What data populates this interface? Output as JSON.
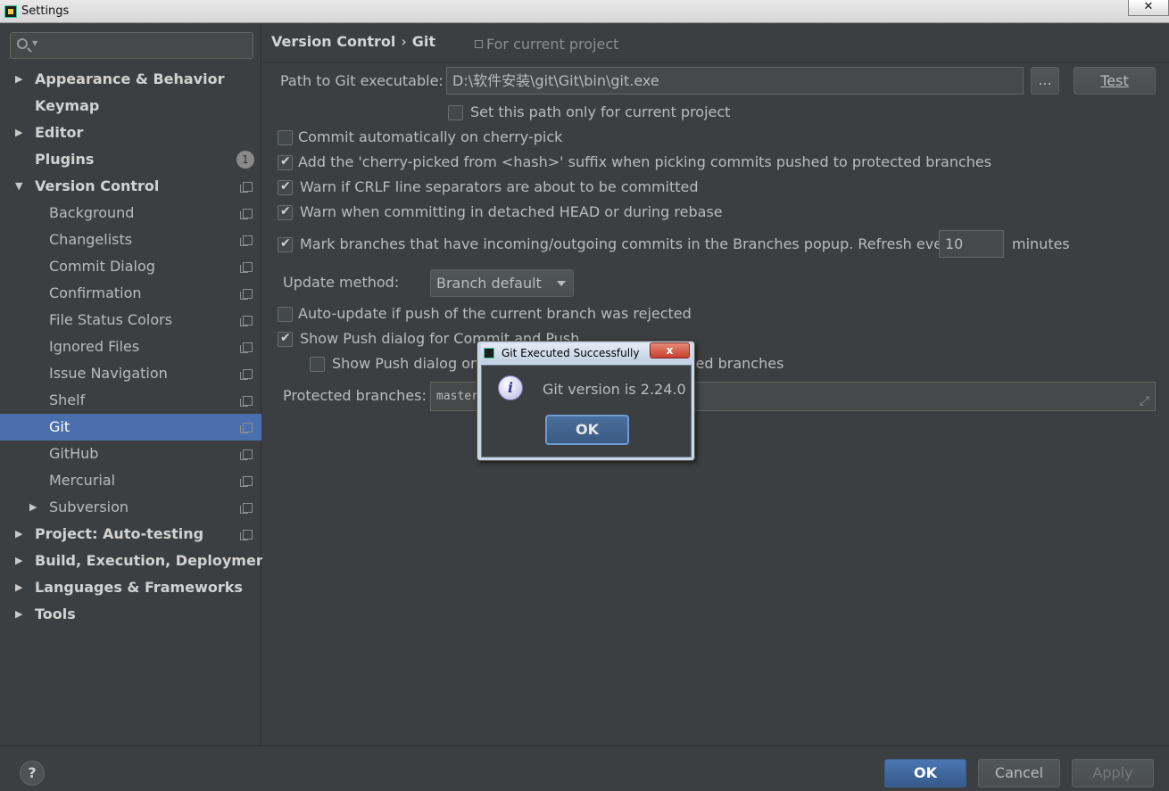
{
  "window": {
    "title": "Settings",
    "close_label": "✕"
  },
  "sidebar": {
    "search_placeholder": "",
    "items": [
      {
        "label": "Appearance & Behavior",
        "level": 0,
        "arrow": "▶"
      },
      {
        "label": "Keymap",
        "level": 0
      },
      {
        "label": "Editor",
        "level": 0,
        "arrow": "▶"
      },
      {
        "label": "Plugins",
        "level": 0,
        "badge": "1"
      },
      {
        "label": "Version Control",
        "level": 0,
        "arrow": "▼"
      },
      {
        "label": "Background",
        "level": 1
      },
      {
        "label": "Changelists",
        "level": 1
      },
      {
        "label": "Commit Dialog",
        "level": 1
      },
      {
        "label": "Confirmation",
        "level": 1
      },
      {
        "label": "File Status Colors",
        "level": 1
      },
      {
        "label": "Ignored Files",
        "level": 1
      },
      {
        "label": "Issue Navigation",
        "level": 1
      },
      {
        "label": "Shelf",
        "level": 1
      },
      {
        "label": "Git",
        "level": 1,
        "selected": true
      },
      {
        "label": "GitHub",
        "level": 1
      },
      {
        "label": "Mercurial",
        "level": 1
      },
      {
        "label": "Subversion",
        "level": 1,
        "arrow": "▶"
      },
      {
        "label": "Project: Auto-testing",
        "level": 0,
        "arrow": "▶"
      },
      {
        "label": "Build, Execution, Deployment",
        "level": 0,
        "arrow": "▶"
      },
      {
        "label": "Languages & Frameworks",
        "level": 0,
        "arrow": "▶"
      },
      {
        "label": "Tools",
        "level": 0,
        "arrow": "▶"
      }
    ]
  },
  "main": {
    "breadcrumb": {
      "parent": "Version Control",
      "separator": "›",
      "current": "Git"
    },
    "scope_note": "For current project",
    "path": {
      "label": "Path to Git executable:",
      "value": "D:\\软件安装\\git\\Git\\bin\\git.exe",
      "browse_label": "...",
      "test_label": "Test"
    },
    "options": {
      "path_only_project": {
        "label": "Set this path only for current project",
        "checked": false
      },
      "commit_cherry_pick": {
        "label": "Commit automatically on cherry-pick",
        "checked": false
      },
      "cherry_suffix": {
        "label": "Add the 'cherry-picked from <hash>' suffix when picking commits pushed to protected branches",
        "checked": true
      },
      "warn_crlf": {
        "label": "Warn if CRLF line separators are about to be committed",
        "checked": true
      },
      "warn_detached": {
        "label": "Warn when committing in detached HEAD or during rebase",
        "checked": true
      },
      "mark_branches": {
        "label": "Mark branches that have incoming/outgoing commits in the Branches popup.  Refresh every",
        "checked": true,
        "refresh_value": "10",
        "refresh_unit": "minutes"
      },
      "auto_update": {
        "label": "Auto-update if push of the current branch was rejected",
        "checked": false
      },
      "show_push": {
        "label": "Show Push dialog for Commit and Push",
        "checked": true
      },
      "show_push_protected": {
        "label": "Show Push dialog only when committing to protected branches",
        "checked": false
      }
    },
    "update_method": {
      "label": "Update method:",
      "value": "Branch default"
    },
    "protected_branches": {
      "label": "Protected branches:",
      "value": "master"
    }
  },
  "footer": {
    "help": "?",
    "ok": "OK",
    "cancel": "Cancel",
    "apply": "Apply"
  },
  "dialog": {
    "title": "Git Executed Successfully",
    "close": "x",
    "icon": "i",
    "message": "Git version is 2.24.0",
    "ok": "OK"
  }
}
